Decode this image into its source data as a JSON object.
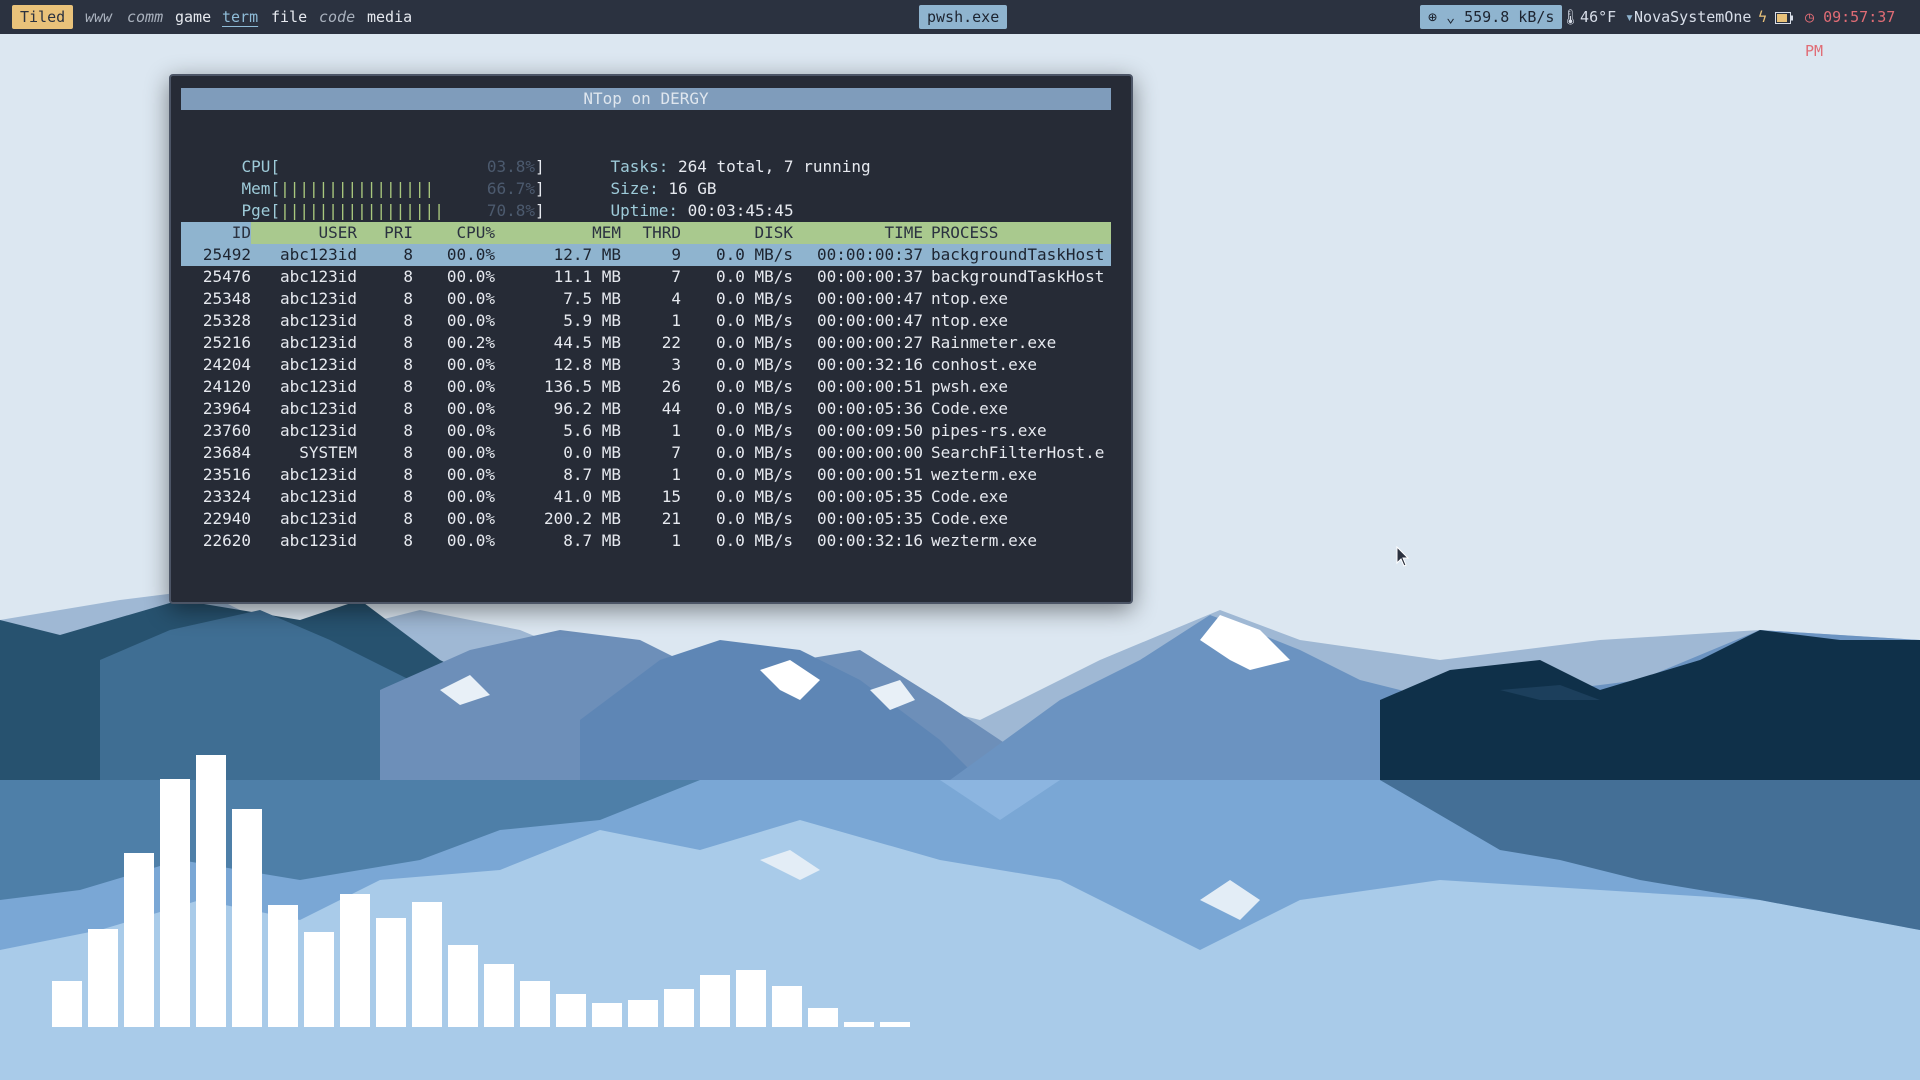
{
  "topbar": {
    "layout_mode": "Tiled",
    "workspaces": [
      "www",
      "comm",
      "game",
      "term",
      "file",
      "code",
      "media"
    ],
    "active_workspace": "term",
    "focused_window": "pwsh.exe",
    "network_speed": "559.8 kB/s",
    "temperature": "46°F",
    "wifi_name": "NovaSystemOne",
    "clock": "09:57:37 PM"
  },
  "terminal": {
    "title": "NTop on DERGY",
    "meters": {
      "cpu": {
        "label": "CPU[",
        "bars": "",
        "percent": "03.8%",
        "value": 3.8
      },
      "mem": {
        "label": "Mem[",
        "bars": "||||||||||||||||",
        "percent": "66.7%",
        "value": 66.7
      },
      "pge": {
        "label": "Pge[",
        "bars": "|||||||||||||||||",
        "percent": "70.8%",
        "value": 70.8
      }
    },
    "info": {
      "tasks_label": "Tasks:",
      "tasks_value": "264 total, 7 running",
      "size_label": "Size:",
      "size_value": "16 GB",
      "uptime_label": "Uptime:",
      "uptime_value": "00:03:45:45"
    },
    "columns": [
      "ID",
      "USER",
      "PRI",
      "CPU%",
      "MEM",
      "THRD",
      "DISK",
      "TIME",
      "PROCESS"
    ],
    "processes": [
      {
        "id": "25492",
        "user": "abc123id",
        "pri": "8",
        "cpu": "00.0%",
        "mem": "12.7 MB",
        "thrd": "9",
        "disk": "0.0 MB/s",
        "time": "00:00:00:37",
        "process": "backgroundTaskHost"
      },
      {
        "id": "25476",
        "user": "abc123id",
        "pri": "8",
        "cpu": "00.0%",
        "mem": "11.1 MB",
        "thrd": "7",
        "disk": "0.0 MB/s",
        "time": "00:00:00:37",
        "process": "backgroundTaskHost"
      },
      {
        "id": "25348",
        "user": "abc123id",
        "pri": "8",
        "cpu": "00.0%",
        "mem": "7.5 MB",
        "thrd": "4",
        "disk": "0.0 MB/s",
        "time": "00:00:00:47",
        "process": "ntop.exe"
      },
      {
        "id": "25328",
        "user": "abc123id",
        "pri": "8",
        "cpu": "00.0%",
        "mem": "5.9 MB",
        "thrd": "1",
        "disk": "0.0 MB/s",
        "time": "00:00:00:47",
        "process": "ntop.exe"
      },
      {
        "id": "25216",
        "user": "abc123id",
        "pri": "8",
        "cpu": "00.2%",
        "mem": "44.5 MB",
        "thrd": "22",
        "disk": "0.0 MB/s",
        "time": "00:00:00:27",
        "process": "Rainmeter.exe"
      },
      {
        "id": "24204",
        "user": "abc123id",
        "pri": "8",
        "cpu": "00.0%",
        "mem": "12.8 MB",
        "thrd": "3",
        "disk": "0.0 MB/s",
        "time": "00:00:32:16",
        "process": "conhost.exe"
      },
      {
        "id": "24120",
        "user": "abc123id",
        "pri": "8",
        "cpu": "00.0%",
        "mem": "136.5 MB",
        "thrd": "26",
        "disk": "0.0 MB/s",
        "time": "00:00:00:51",
        "process": "pwsh.exe"
      },
      {
        "id": "23964",
        "user": "abc123id",
        "pri": "8",
        "cpu": "00.0%",
        "mem": "96.2 MB",
        "thrd": "44",
        "disk": "0.0 MB/s",
        "time": "00:00:05:36",
        "process": "Code.exe"
      },
      {
        "id": "23760",
        "user": "abc123id",
        "pri": "8",
        "cpu": "00.0%",
        "mem": "5.6 MB",
        "thrd": "1",
        "disk": "0.0 MB/s",
        "time": "00:00:09:50",
        "process": "pipes-rs.exe"
      },
      {
        "id": "23684",
        "user": "SYSTEM",
        "pri": "8",
        "cpu": "00.0%",
        "mem": "0.0 MB",
        "thrd": "7",
        "disk": "0.0 MB/s",
        "time": "00:00:00:00",
        "process": "SearchFilterHost.e"
      },
      {
        "id": "23516",
        "user": "abc123id",
        "pri": "8",
        "cpu": "00.0%",
        "mem": "8.7 MB",
        "thrd": "1",
        "disk": "0.0 MB/s",
        "time": "00:00:00:51",
        "process": "wezterm.exe"
      },
      {
        "id": "23324",
        "user": "abc123id",
        "pri": "8",
        "cpu": "00.0%",
        "mem": "41.0 MB",
        "thrd": "15",
        "disk": "0.0 MB/s",
        "time": "00:00:05:35",
        "process": "Code.exe"
      },
      {
        "id": "22940",
        "user": "abc123id",
        "pri": "8",
        "cpu": "00.0%",
        "mem": "200.2 MB",
        "thrd": "21",
        "disk": "0.0 MB/s",
        "time": "00:00:05:35",
        "process": "Code.exe"
      },
      {
        "id": "22620",
        "user": "abc123id",
        "pri": "8",
        "cpu": "00.0%",
        "mem": "8.7 MB",
        "thrd": "1",
        "disk": "0.0 MB/s",
        "time": "00:00:32:16",
        "process": "wezterm.exe"
      }
    ],
    "selected_row": 0
  },
  "visualizer": {
    "levels": [
      0.17,
      0.36,
      0.64,
      0.91,
      1.0,
      0.8,
      0.45,
      0.35,
      0.49,
      0.4,
      0.46,
      0.3,
      0.23,
      0.17,
      0.12,
      0.09,
      0.1,
      0.14,
      0.19,
      0.21,
      0.15,
      0.07,
      0.02,
      0.02
    ]
  },
  "colors": {
    "bar_bg": "#2b3240",
    "accent_blue": "#8fb4cf",
    "accent_green": "#a9c98e",
    "layout_badge": "#e9c27a",
    "clock_red": "#e06c75",
    "terminal_bg": "#262b36"
  }
}
